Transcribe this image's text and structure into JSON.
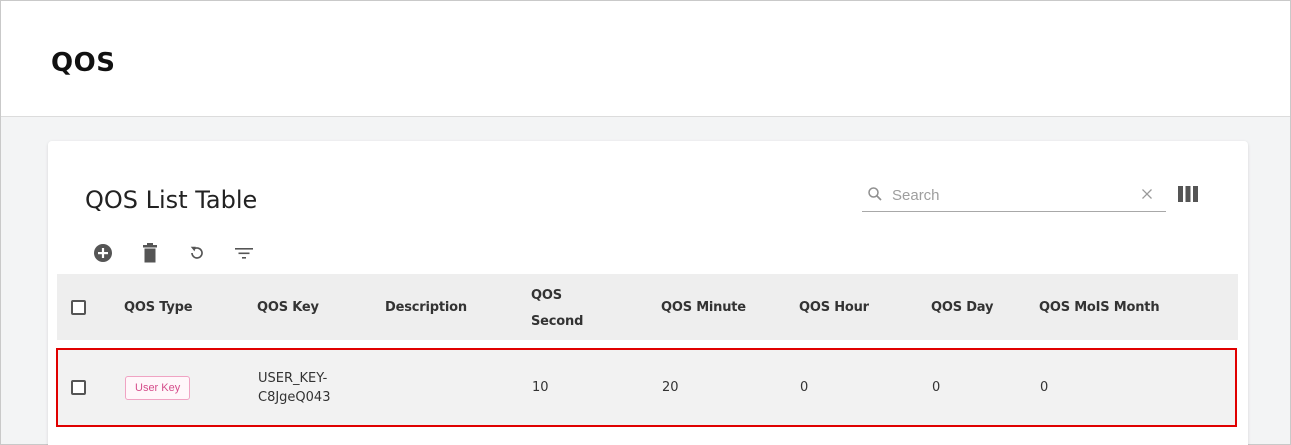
{
  "header": {
    "title": "QOS"
  },
  "card": {
    "title": "QOS List Table",
    "search": {
      "placeholder": "Search",
      "value": ""
    },
    "toolbar": [
      "add-icon",
      "delete-icon",
      "refresh-icon",
      "filter-icon"
    ]
  },
  "table": {
    "columns": [
      "QOS Type",
      "QOS Key",
      "Description",
      "QOS",
      "Second",
      "QOS Minute",
      "QOS Hour",
      "QOS Day",
      "QOS MoIS Month"
    ],
    "rows": [
      {
        "type": "User Key",
        "key_line1": "USER_KEY-",
        "key_line2": "C8JgeQ043",
        "description": "",
        "second": "10",
        "minute": "20",
        "hour": "0",
        "day": "0",
        "month": "0"
      }
    ]
  },
  "colors": {
    "highlight_border": "#e00000",
    "badge_text": "#d54d8b",
    "badge_border": "#f0a3c3"
  }
}
